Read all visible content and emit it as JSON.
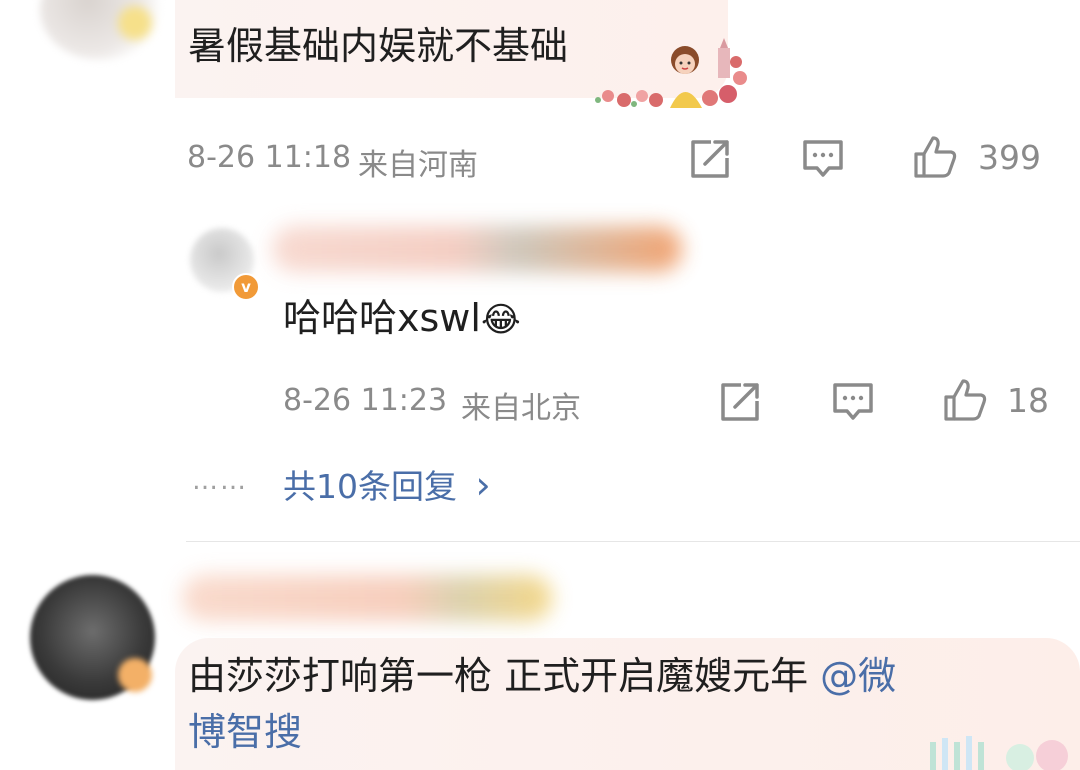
{
  "comment1": {
    "text": "暑假基础内娱就不基础",
    "time": "8-26 11:18",
    "location": "来自河南",
    "likes": "399"
  },
  "reply": {
    "badge": "v",
    "text": "哈哈哈xswl",
    "emoji": "😂",
    "time": "8-26 11:23",
    "location": "来自北京",
    "likes": "18"
  },
  "more_replies": {
    "ellipsis": "……",
    "label": "共10条回复",
    "chevron": "›"
  },
  "comment2": {
    "text_line1": "由莎莎打响第一枪 正式开启魔嫂元年 ",
    "mention_part1": "@微",
    "mention_part2": "博智搜"
  },
  "icons": {
    "share": "share-icon",
    "comment": "comment-icon",
    "like": "thumbs-up-icon"
  },
  "colors": {
    "text": "#1f1f1f",
    "meta": "#8a8a8a",
    "link": "#4a6ea8",
    "bubble": "#fbf3f1"
  }
}
